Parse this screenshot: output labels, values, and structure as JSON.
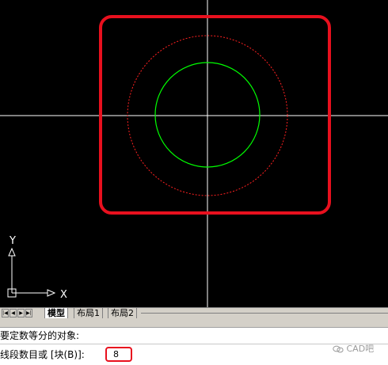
{
  "app": "CAD drawing canvas",
  "canvas": {
    "background": "#000000",
    "crosshair_color": "#ffffff",
    "inner_circle_color": "#00ff00",
    "outer_circle_color": "#ff0000",
    "outer_circle_style": "dashed",
    "highlight_color": "#e8101e"
  },
  "ucs": {
    "x_label": "X",
    "y_label": "Y"
  },
  "tabs": {
    "nav_first": "|◀",
    "nav_prev": "◀",
    "nav_next": "▶",
    "nav_last": "▶|",
    "items": [
      {
        "label": "模型",
        "active": true
      },
      {
        "label": "布局1",
        "active": false
      },
      {
        "label": "布局2",
        "active": false
      }
    ]
  },
  "command": {
    "line1": "要定数等分的对象:",
    "line2_prompt": "线段数目或 [块(B)]:",
    "input_value": "8"
  },
  "watermark": {
    "text": "CAD吧",
    "icon": "wechat-icon"
  }
}
